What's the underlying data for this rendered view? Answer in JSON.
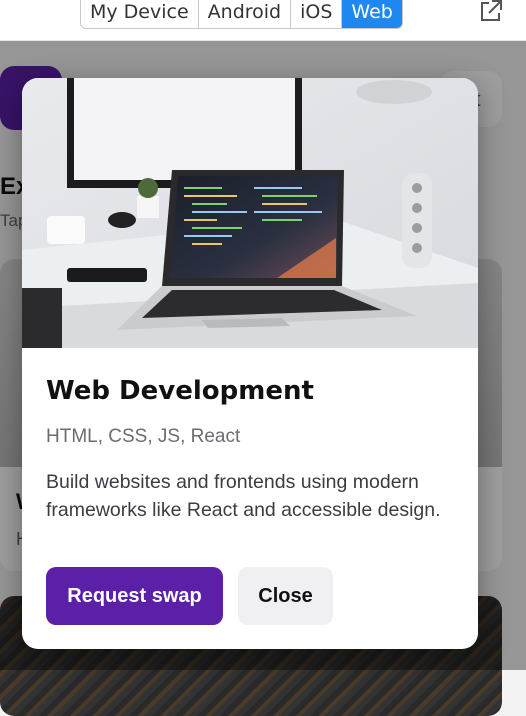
{
  "toolbar": {
    "tabs": [
      {
        "label": "My Device",
        "active": false
      },
      {
        "label": "Android",
        "active": false
      },
      {
        "label": "iOS",
        "active": false
      },
      {
        "label": "Web",
        "active": true
      }
    ],
    "external_icon": "external-link-icon",
    "accent": "#1e88f0"
  },
  "background": {
    "pill_text": "t",
    "heading": "Ex",
    "subheading": "Tap",
    "card_title": "W",
    "card_subtitle": "H"
  },
  "modal": {
    "image_icon": "laptop-desk-photo",
    "title": "Web Development",
    "tags": "HTML, CSS, JS, React",
    "description": "Build websites and frontends using modern frameworks like React and accessible design.",
    "primary_button": "Request swap",
    "secondary_button": "Close",
    "primary_color": "#5b1fa8"
  }
}
